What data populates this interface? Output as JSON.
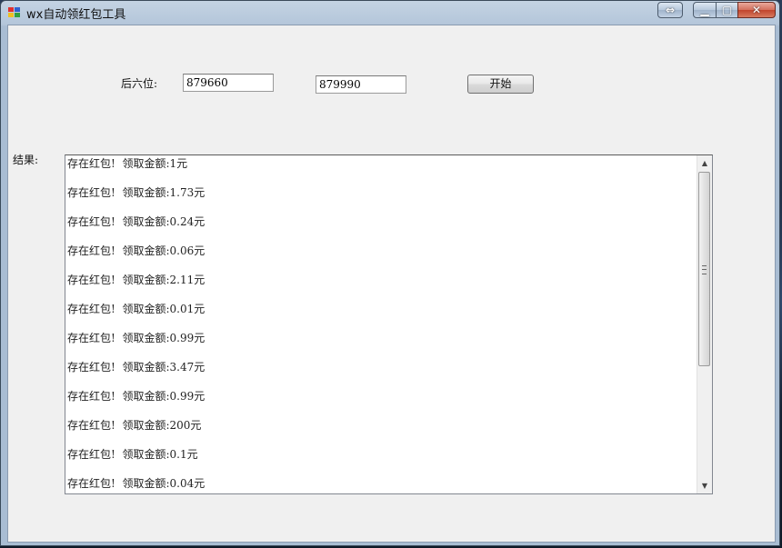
{
  "window": {
    "title": "wx自动领红包工具",
    "buttons": {
      "extra": "⇔",
      "minimize": "▁",
      "maximize": "▢",
      "close": "✕"
    }
  },
  "form": {
    "last_six_label": "后六位:",
    "range_start": "879660",
    "range_end": "879990",
    "start_button": "开始",
    "result_label": "结果:"
  },
  "results": [
    "存在红包!  领取金额:1元",
    "存在红包!  领取金额:1.73元",
    "存在红包!  领取金额:0.24元",
    "存在红包!  领取金额:0.06元",
    "存在红包!  领取金额:2.11元",
    "存在红包!  领取金额:0.01元",
    "存在红包!  领取金额:0.99元",
    "存在红包!  领取金额:3.47元",
    "存在红包!  领取金额:0.99元",
    "存在红包!  领取金额:200元",
    "存在红包!  领取金额:0.1元",
    "存在红包!  领取金额:0.04元"
  ],
  "colors": {
    "client_bg": "#f0f0f0",
    "close_button": "#c1442c"
  }
}
